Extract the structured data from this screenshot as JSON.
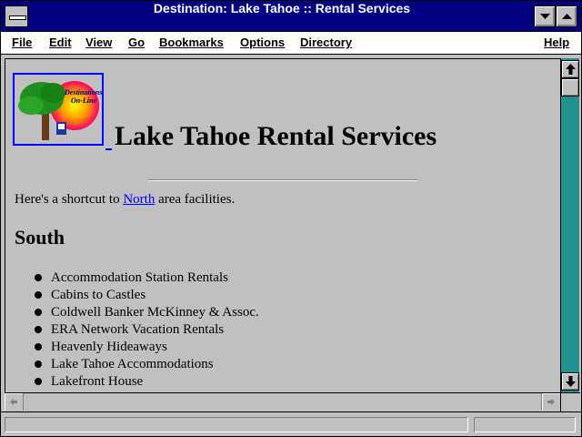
{
  "window": {
    "title": "Destination: Lake Tahoe :: Rental Services"
  },
  "menu": {
    "items": [
      "File",
      "Edit",
      "View",
      "Go",
      "Bookmarks",
      "Options",
      "Directory",
      "Help"
    ]
  },
  "page": {
    "logo_text": "Destinations On-Line",
    "heading": "Lake Tahoe Rental Services",
    "shortcut_prefix": "Here's a shortcut to ",
    "shortcut_link": "North",
    "shortcut_suffix": " area facilities.",
    "section_title": "South",
    "south_list": [
      "Accommodation Station Rentals",
      "Cabins to Castles",
      "Coldwell Banker McKinney & Assoc.",
      "ERA Network Vacation Rentals",
      "Heavenly Hideaways",
      "Lake Tahoe Accommodations",
      "Lakefront House"
    ]
  },
  "colors": {
    "titlebar": "#000080",
    "link": "#0000ff",
    "background": "#c0c0c0",
    "scroll_track": "#008080"
  }
}
